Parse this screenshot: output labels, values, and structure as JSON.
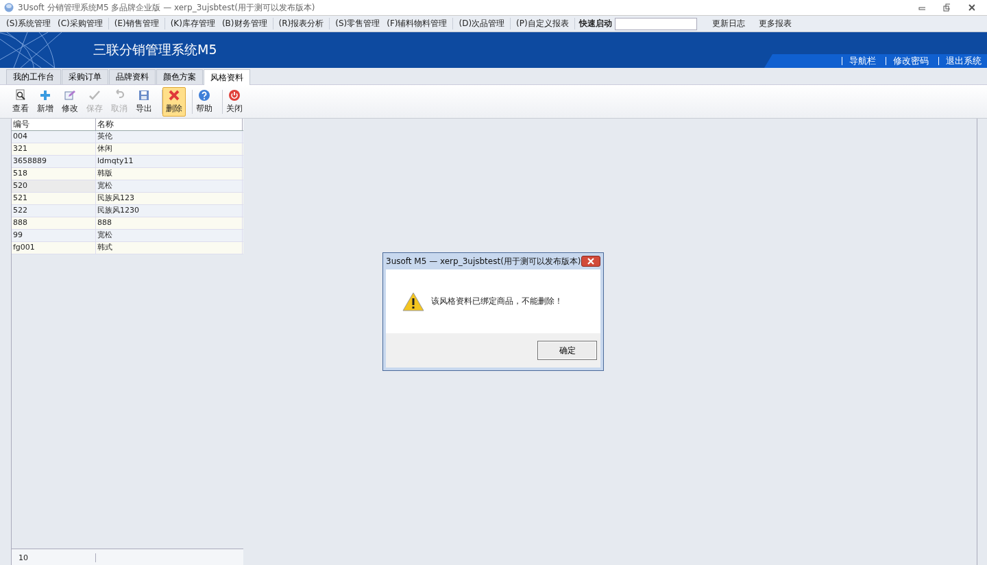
{
  "window": {
    "title": "3Usoft 分销管理系统M5 多品牌企业版 — xerp_3ujsbtest(用于测可以发布版本)"
  },
  "menu": [
    {
      "label": "(S)系统管理",
      "divider_before": false
    },
    {
      "label": "(C)采购管理",
      "divider_before": false
    },
    {
      "label": "(E)销售管理",
      "divider_before": true
    },
    {
      "label": "(K)库存管理",
      "divider_before": true
    },
    {
      "label": "(B)财务管理",
      "divider_before": false
    },
    {
      "label": "(R)报表分析",
      "divider_before": true
    },
    {
      "label": "(S)零售管理",
      "divider_before": true
    },
    {
      "label": "(F)辅料物料管理",
      "divider_before": false
    },
    {
      "label": "(D)次品管理",
      "divider_before": true
    },
    {
      "label": "(P)自定义报表",
      "divider_before": true
    }
  ],
  "quick_launch": {
    "label": "快速启动"
  },
  "menu_links": [
    "更新日志",
    "更多报表"
  ],
  "banner": {
    "title": "三联分销管理系统M5",
    "links": [
      "导航栏",
      "修改密码",
      "退出系统"
    ]
  },
  "tabs": [
    {
      "label": "我的工作台",
      "selected": false
    },
    {
      "label": "采购订单",
      "selected": false
    },
    {
      "label": "品牌资料",
      "selected": false
    },
    {
      "label": "颜色方案",
      "selected": false
    },
    {
      "label": "风格资料",
      "selected": true
    }
  ],
  "toolbar": [
    {
      "kind": "view",
      "label": "查看",
      "disabled": false,
      "selected": false,
      "divider_before": false
    },
    {
      "kind": "add",
      "label": "新增",
      "disabled": false,
      "selected": false,
      "divider_before": false
    },
    {
      "kind": "edit",
      "label": "修改",
      "disabled": false,
      "selected": false,
      "divider_before": false
    },
    {
      "kind": "save",
      "label": "保存",
      "disabled": true,
      "selected": false,
      "divider_before": false
    },
    {
      "kind": "undo",
      "label": "取消",
      "disabled": true,
      "selected": false,
      "divider_before": false
    },
    {
      "kind": "export",
      "label": "导出",
      "disabled": false,
      "selected": false,
      "divider_before": false
    },
    {
      "kind": "delete",
      "label": "删除",
      "disabled": false,
      "selected": true,
      "divider_before": true
    },
    {
      "kind": "help",
      "label": "帮助",
      "disabled": false,
      "selected": false,
      "divider_before": true
    },
    {
      "kind": "close",
      "label": "关闭",
      "disabled": false,
      "selected": false,
      "divider_before": true
    }
  ],
  "table": {
    "columns": [
      "编号",
      "名称"
    ],
    "rows": [
      {
        "cells": [
          "004",
          "英伦"
        ],
        "selected": false
      },
      {
        "cells": [
          "321",
          "休闲"
        ],
        "selected": false
      },
      {
        "cells": [
          "3658889",
          "ldmqty11"
        ],
        "selected": false
      },
      {
        "cells": [
          "518",
          "韩版"
        ],
        "selected": false
      },
      {
        "cells": [
          "520",
          "宽松"
        ],
        "selected": true
      },
      {
        "cells": [
          "521",
          "民族风123"
        ],
        "selected": false
      },
      {
        "cells": [
          "522",
          "民族风1230"
        ],
        "selected": false
      },
      {
        "cells": [
          "888",
          "888"
        ],
        "selected": false
      },
      {
        "cells": [
          "99",
          "宽松"
        ],
        "selected": false
      },
      {
        "cells": [
          "fg001",
          "韩式"
        ],
        "selected": false
      }
    ],
    "footer": "10"
  },
  "dialog": {
    "title": "3usoft M5 — xerp_3ujsbtest(用于测可以发布版本)",
    "message": "该风格资料已绑定商品，不能删除！",
    "button": "确定"
  }
}
